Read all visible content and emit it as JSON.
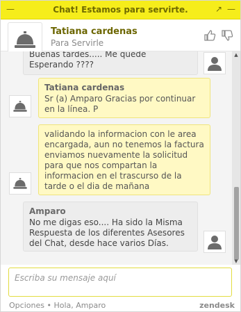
{
  "topbar": {
    "title": "Chat! Estamos para servirte.",
    "expand_icon": "arrow-diagonal-icon",
    "minimize_icon": "minus-icon"
  },
  "header": {
    "agent_name": "Tatiana cardenas",
    "agent_status": "Para Servirle",
    "avatar_icon": "service-bell-icon",
    "thumbs_up_icon": "thumbs-up-icon",
    "thumbs_down_icon": "thumbs-down-icon"
  },
  "messages": [
    {
      "type": "visitor",
      "sender": "",
      "text": "Buenas tardes..... Me quede Esperando ????"
    },
    {
      "type": "agent",
      "sender": "Tatiana cardenas",
      "text": "Sr (a) Amparo Gracias por continuar en la línea. P"
    },
    {
      "type": "agent",
      "sender": "",
      "text": "validando la informacion con le area encargada, aun no tenemos la factura enviamos nuevamente la solicitud para que nos compartan la informacion en el trascurso de la tarde o el dia de mañana"
    },
    {
      "type": "visitor",
      "sender": "Amparo",
      "text": "No me digas eso.... Ha sido la Misma Respuesta de los diferentes Asesores del Chat, desde hace varios Días."
    }
  ],
  "input": {
    "placeholder": "Escriba su mensaje aquí"
  },
  "footer": {
    "options": "Opciones",
    "separator": "•",
    "greeting": "Hola, Amparo",
    "brand": "zendesk"
  },
  "colors": {
    "topbar": "#f6ed1b",
    "agent_bubble": "#fff9c4",
    "visitor_bubble": "#ededed",
    "agent_name": "#6c6600"
  }
}
